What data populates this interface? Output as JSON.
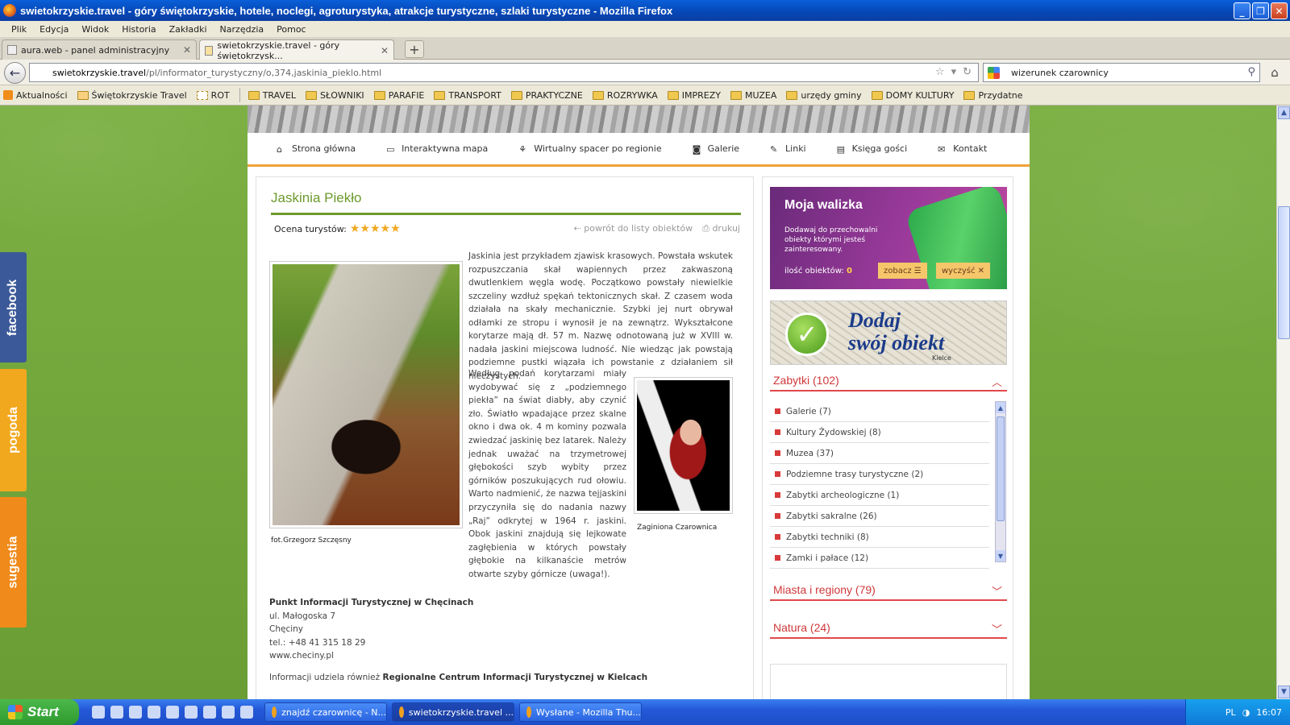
{
  "window": {
    "title": "swietokrzyskie.travel - góry świętokrzyskie, hotele, noclegi, agroturystyka, atrakcje turystyczne, szlaki turystyczne - Mozilla Firefox",
    "min": "_",
    "max": "❐",
    "close": "✕"
  },
  "menu": [
    "Plik",
    "Edycja",
    "Widok",
    "Historia",
    "Zakładki",
    "Narzędzia",
    "Pomoc"
  ],
  "tabs": [
    {
      "label": "aura.web - panel administracyjny",
      "close": "✕"
    },
    {
      "label": "swietokrzyskie.travel - góry świętokrzysk...",
      "close": "✕"
    }
  ],
  "newtab": "+",
  "url": {
    "domain": "swietokrzyskie.travel",
    "path": "/pl/informator_turystyczny/o,374,jaskinia_pieklo.html"
  },
  "search": {
    "value": "wizerunek czarownicy"
  },
  "bookmarks": [
    {
      "label": "Aktualności",
      "icon": "rss-icon"
    },
    {
      "label": "Świętokrzyskie Travel",
      "icon": "site-icon"
    },
    {
      "label": "ROT",
      "icon": "page-icon"
    },
    {
      "label": "TRAVEL",
      "icon": "folder-icon"
    },
    {
      "label": "SŁOWNIKI",
      "icon": "folder-icon"
    },
    {
      "label": "PARAFIE",
      "icon": "folder-icon"
    },
    {
      "label": "TRANSPORT",
      "icon": "folder-icon"
    },
    {
      "label": "PRAKTYCZNE",
      "icon": "folder-icon"
    },
    {
      "label": "ROZRYWKA",
      "icon": "folder-icon"
    },
    {
      "label": "IMPREZY",
      "icon": "folder-icon"
    },
    {
      "label": "MUZEA",
      "icon": "folder-icon"
    },
    {
      "label": "urzędy gminy",
      "icon": "folder-icon"
    },
    {
      "label": "DOMY KULTURY",
      "icon": "folder-icon"
    },
    {
      "label": "Przydatne",
      "icon": "folder-icon"
    }
  ],
  "sidetabs": {
    "facebook": "facebook",
    "pogoda": "pogoda",
    "sugestia": "sugestia"
  },
  "nav": [
    {
      "label": "Strona główna",
      "icon": "home-icon"
    },
    {
      "label": "Interaktywna mapa",
      "icon": "monitor-icon"
    },
    {
      "label": "Wirtualny spacer po regionie",
      "icon": "walker-icon"
    },
    {
      "label": "Galerie",
      "icon": "camera-icon"
    },
    {
      "label": "Linki",
      "icon": "edit-icon"
    },
    {
      "label": "Księga gości",
      "icon": "book-icon"
    },
    {
      "label": "Kontakt",
      "icon": "mail-icon"
    }
  ],
  "article": {
    "title": "Jaskinia Piekło",
    "rating_label": "Ocena turystów:",
    "stars": "★★★★★",
    "back": "powrót do listy obiektów",
    "print": "drukuj",
    "photo1_caption": "fot.Grzegorz Szczęsny",
    "photo2_caption": "Zaginiona Czarownica",
    "para1": "Jaskinia jest przykładem zjawisk krasowych. Powstała wskutek rozpuszczania skał wapiennych przez zakwaszoną dwutlenkiem węgla wodę. Początkowo powstały niewielkie szczeliny wzdłuż spękań tektonicznych skał. Z czasem woda działała na skały mechanicznie. Szybki jej nurt obrywał odłamki ze stropu i wynosił je na zewnątrz. Wykształcone korytarze mają dł. 57 m. Nazwę odnotowaną już w XVIII w. nadała jaskini miejscowa ludność. Nie wiedząc jak powstają podziemne pustki wiązała ich powstanie z działaniem sił nieczystych.",
    "para2": "Według podań korytarzami miały wydobywać się z „podziemnego piekła” na świat diabły, aby czynić zło. Światło wpadające przez skalne okno i dwa ok. 4 m kominy pozwala zwiedzać jaskinię bez latarek. Należy jednak uważać na trzymetrowej głębokości szyb wybity przez górników poszukujących rud ołowiu. Warto nadmienić, że nazwa tejjaskini przyczyniła się do nadania nazwy „Raj” odkrytej w 1964 r. jaskini. Obok jaskini znajdują się lejkowate zagłębienia w których powstały głębokie na kilkanaście metrów otwarte szyby górnicze (uwaga!).",
    "info_name": "Punkt Informacji Turystycznej w Chęcinach",
    "info_street": "ul. Małogoska 7",
    "info_city": "Chęciny",
    "info_tel": "tel.: +48 41 315 18 29",
    "info_www": "www.checiny.pl",
    "info_also": "Informacji udziela również",
    "info_also_b": "Regionalne Centrum Informacji Turystycznej w Kielcach"
  },
  "walizka": {
    "title": "Moja walizka",
    "desc": "Dodawaj do przechowalni obiekty którymi jesteś zainteresowany.",
    "count_label": "ilość obiektów:",
    "count": "0",
    "show": "zobacz ☰",
    "clear": "wyczyść ✕"
  },
  "dodaj": {
    "line1": "Dodaj",
    "line2": "swój obiekt",
    "city": "Kielce"
  },
  "sections": {
    "zabytki": "Zabytki (102)",
    "miasta": "Miasta i regiony (79)",
    "natura": "Natura (24)"
  },
  "categories": [
    "Galerie (7)",
    "Kultury Żydowskiej (8)",
    "Muzea (37)",
    "Podziemne trasy turystyczne (2)",
    "Zabytki archeologiczne (1)",
    "Zabytki sakralne (26)",
    "Zabytki techniki (8)",
    "Zamki i pałace (12)"
  ],
  "taskbar": {
    "start": "Start",
    "items": [
      {
        "label": "znajdź czarownicę - N..."
      },
      {
        "label": "swietokrzyskie.travel ..."
      },
      {
        "label": "Wysłane - Mozilla Thu..."
      }
    ],
    "lang": "PL",
    "time": "16:07"
  },
  "colors": {
    "accent_green": "#6c9a2c",
    "accent_red": "#d0383a",
    "nav_underline": "#f0a23a"
  }
}
